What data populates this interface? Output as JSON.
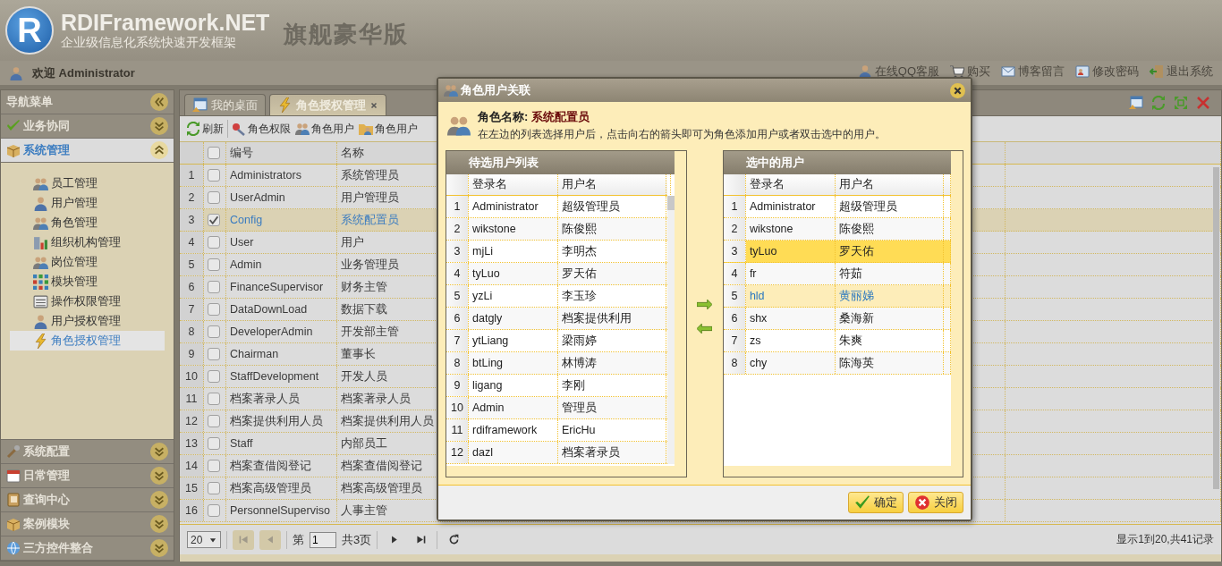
{
  "header": {
    "logo_letter": "R",
    "title": "RDIFramework.NET",
    "subtitle": "企业级信息化系统快速开发框架",
    "edition": "旗舰豪华版"
  },
  "topbar": {
    "welcome": "欢迎 Administrator",
    "links": [
      "在线QQ客服",
      "购买",
      "博客留言",
      "修改密码",
      "退出系统"
    ]
  },
  "sidebar": {
    "title": "导航菜单",
    "sections": [
      {
        "label": "业务协同",
        "expanded": false
      },
      {
        "label": "系统管理",
        "expanded": true,
        "items": [
          {
            "label": "员工管理",
            "selected": false
          },
          {
            "label": "用户管理",
            "selected": false
          },
          {
            "label": "角色管理",
            "selected": false
          },
          {
            "label": "组织机构管理",
            "selected": false
          },
          {
            "label": "岗位管理",
            "selected": false
          },
          {
            "label": "模块管理",
            "selected": false
          },
          {
            "label": "操作权限管理",
            "selected": false
          },
          {
            "label": "用户授权管理",
            "selected": false
          },
          {
            "label": "角色授权管理",
            "selected": true
          }
        ]
      },
      {
        "label": "系统配置",
        "expanded": false
      },
      {
        "label": "日常管理",
        "expanded": false
      },
      {
        "label": "查询中心",
        "expanded": false
      },
      {
        "label": "案例模块",
        "expanded": false
      },
      {
        "label": "三方控件整合",
        "expanded": false
      }
    ]
  },
  "tabs": [
    {
      "label": "我的桌面",
      "selected": false,
      "closable": false
    },
    {
      "label": "角色授权管理",
      "selected": true,
      "closable": true
    }
  ],
  "toolbar": [
    "刷新",
    "角色权限",
    "角色用户",
    "角色用户"
  ],
  "table": {
    "select_all_checked": false,
    "columns": [
      "编号",
      "名称"
    ],
    "rows": [
      {
        "num": "1",
        "code": "Administrators",
        "name": "系统管理员",
        "checked": false,
        "selected": false
      },
      {
        "num": "2",
        "code": "UserAdmin",
        "name": "用户管理员",
        "checked": false,
        "selected": false
      },
      {
        "num": "3",
        "code": "Config",
        "name": "系统配置员",
        "checked": true,
        "selected": true
      },
      {
        "num": "4",
        "code": "User",
        "name": "用户",
        "checked": false,
        "selected": false
      },
      {
        "num": "5",
        "code": "Admin",
        "name": "业务管理员",
        "checked": false,
        "selected": false
      },
      {
        "num": "6",
        "code": "FinanceSupervisor",
        "name": "财务主管",
        "checked": false,
        "selected": false
      },
      {
        "num": "7",
        "code": "DataDownLoad",
        "name": "数据下载",
        "checked": false,
        "selected": false
      },
      {
        "num": "8",
        "code": "DeveloperAdmin",
        "name": "开发部主管",
        "checked": false,
        "selected": false
      },
      {
        "num": "9",
        "code": "Chairman",
        "name": "董事长",
        "checked": false,
        "selected": false
      },
      {
        "num": "10",
        "code": "StaffDevelopment",
        "name": "开发人员",
        "checked": false,
        "selected": false
      },
      {
        "num": "11",
        "code": "档案著录人员",
        "name": "档案著录人员",
        "checked": false,
        "selected": false
      },
      {
        "num": "12",
        "code": "档案提供利用人员",
        "name": "档案提供利用人员",
        "checked": false,
        "selected": false
      },
      {
        "num": "13",
        "code": "Staff",
        "name": "内部员工",
        "checked": false,
        "selected": false
      },
      {
        "num": "14",
        "code": "档案查借阅登记",
        "name": "档案查借阅登记",
        "checked": false,
        "selected": false
      },
      {
        "num": "15",
        "code": "档案高级管理员",
        "name": "档案高级管理员",
        "checked": false,
        "selected": false
      },
      {
        "num": "16",
        "code": "PersonnelSuperviso",
        "name": "人事主管",
        "checked": false,
        "selected": false
      }
    ]
  },
  "pager": {
    "page_size": "20",
    "page_label": "第",
    "page": "1",
    "total_pages": "共3页",
    "summary": "显示1到20,共41记录",
    "nav_buttons": [
      {
        "kind": "first",
        "disabled": true
      },
      {
        "kind": "prev",
        "disabled": true
      },
      {
        "kind": "next",
        "disabled": false
      },
      {
        "kind": "last",
        "disabled": false
      }
    ]
  },
  "dialog": {
    "title": "角色用户关联",
    "role_label": "角色名称:",
    "role_name": "系统配置员",
    "hint": "在左边的列表选择用户后，点击向右的箭头即可为角色添加用户或者双击选中的用户。",
    "available": {
      "title": "待选用户列表",
      "columns": [
        "登录名",
        "用户名"
      ],
      "rows": [
        {
          "num": "1",
          "login": "Administrator",
          "name": "超级管理员",
          "selected": false,
          "highlighted": false
        },
        {
          "num": "2",
          "login": "wikstone",
          "name": "陈俊熙",
          "selected": false,
          "highlighted": false
        },
        {
          "num": "3",
          "login": "mjLi",
          "name": "李明杰",
          "selected": false,
          "highlighted": false
        },
        {
          "num": "4",
          "login": "tyLuo",
          "name": "罗天佑",
          "selected": false,
          "highlighted": false
        },
        {
          "num": "5",
          "login": "yzLi",
          "name": "李玉珍",
          "selected": false,
          "highlighted": false
        },
        {
          "num": "6",
          "login": "datgly",
          "name": "档案提供利用",
          "selected": false,
          "highlighted": false
        },
        {
          "num": "7",
          "login": "ytLiang",
          "name": "梁雨婷",
          "selected": false,
          "highlighted": false
        },
        {
          "num": "8",
          "login": "btLing",
          "name": "林博涛",
          "selected": false,
          "highlighted": false
        },
        {
          "num": "9",
          "login": "ligang",
          "name": "李刚",
          "selected": false,
          "highlighted": false
        },
        {
          "num": "10",
          "login": "Admin",
          "name": "管理员",
          "selected": false,
          "highlighted": false
        },
        {
          "num": "11",
          "login": "rdiframework",
          "name": "EricHu",
          "selected": false,
          "highlighted": false
        },
        {
          "num": "12",
          "login": "dazl",
          "name": "档案著录员",
          "selected": false,
          "highlighted": false
        }
      ]
    },
    "chosen": {
      "title": "选中的用户",
      "columns": [
        "登录名",
        "用户名"
      ],
      "rows": [
        {
          "num": "1",
          "login": "Administrator",
          "name": "超级管理员",
          "selected": false,
          "highlighted": false
        },
        {
          "num": "2",
          "login": "wikstone",
          "name": "陈俊熙",
          "selected": false,
          "highlighted": false
        },
        {
          "num": "3",
          "login": "tyLuo",
          "name": "罗天佑",
          "selected": true,
          "highlighted": false
        },
        {
          "num": "4",
          "login": "fr",
          "name": "符茹",
          "selected": false,
          "highlighted": false
        },
        {
          "num": "5",
          "login": "hld",
          "name": "黄丽娣",
          "selected": false,
          "highlighted": true
        },
        {
          "num": "6",
          "login": "shx",
          "name": "桑海新",
          "selected": false,
          "highlighted": false
        },
        {
          "num": "7",
          "login": "zs",
          "name": "朱爽",
          "selected": false,
          "highlighted": false
        },
        {
          "num": "8",
          "login": "chy",
          "name": "陈海英",
          "selected": false,
          "highlighted": false
        }
      ]
    },
    "buttons": [
      {
        "kind": "ok",
        "label": "确定"
      },
      {
        "kind": "close",
        "label": "关闭"
      }
    ]
  }
}
